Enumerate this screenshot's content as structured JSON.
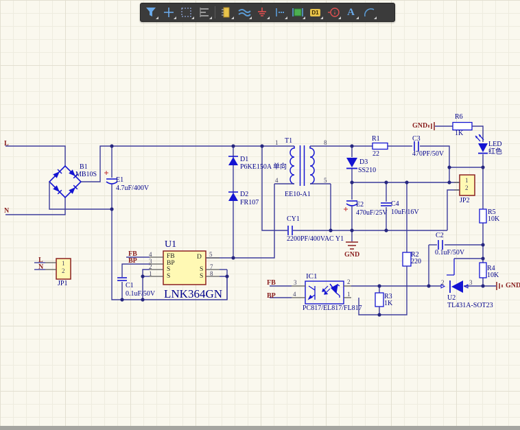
{
  "toolbar": {
    "icons": [
      "filter",
      "move",
      "select",
      "align",
      "part",
      "wire",
      "ground",
      "power-port",
      "ic",
      "designator",
      "info",
      "text",
      "arc"
    ],
    "d1_label": "D1",
    "text_label": "A"
  },
  "nets": {
    "l": "L",
    "n": "N",
    "fb": "FB",
    "bp": "BP",
    "gnd": "GND"
  },
  "c": {
    "b1": {
      "designator": "B1",
      "value": "MB10S"
    },
    "e1": {
      "designator": "E1",
      "value": "4.7uF/400V"
    },
    "d1": {
      "designator": "D1",
      "value": "P6KE150A 单向"
    },
    "d2": {
      "designator": "D2",
      "value": "FR107"
    },
    "t1": {
      "designator": "T1",
      "value": "EE10-A1",
      "pins": [
        "1",
        "8",
        "4",
        "5"
      ]
    },
    "cy1": {
      "designator": "CY1",
      "value": "2200PF/400VAC Y1"
    },
    "u1": {
      "designator": "U1",
      "value": "LNK364GN",
      "pn": [
        "4",
        "3",
        "2",
        "1",
        "5",
        "7",
        "8"
      ],
      "names": [
        "FB",
        "BP",
        "S",
        "S",
        "D",
        "S",
        "S"
      ]
    },
    "c1": {
      "designator": "C1",
      "value": "0.1uF/50V"
    },
    "jp1": {
      "designator": "JP1",
      "pins": [
        "1",
        "2"
      ]
    },
    "d3": {
      "designator": "D3",
      "value": "SS210"
    },
    "r1": {
      "designator": "R1",
      "value": "22"
    },
    "c3": {
      "designator": "C3",
      "value": "470PF/50V"
    },
    "r6": {
      "designator": "R6",
      "value": "1K"
    },
    "led": {
      "designator": "LED",
      "value": "红色"
    },
    "jp2": {
      "designator": "JP2",
      "pins": [
        "1",
        "2"
      ]
    },
    "r5": {
      "designator": "R5",
      "value": "10K"
    },
    "e2": {
      "designator": "E2",
      "value": "470uF/25V"
    },
    "c4": {
      "designator": "C4",
      "value": "10uF/16V"
    },
    "r2": {
      "designator": "R2",
      "value": "220"
    },
    "c2": {
      "designator": "C2",
      "value": "0.1uF/50V"
    },
    "ic1": {
      "designator": "IC1",
      "value": "PC817/EL817/FL817",
      "pn": [
        "3",
        "4",
        "2",
        "1"
      ]
    },
    "r3": {
      "designator": "R3",
      "value": "1K"
    },
    "r4": {
      "designator": "R4",
      "value": "10K"
    },
    "u2": {
      "designator": "U2",
      "value": "TL431A-SOT23",
      "pn": [
        "2",
        "3"
      ]
    }
  },
  "colors": {
    "wire": "#3c3c9c",
    "symbol": "#1414d2",
    "junction": "#26267f",
    "pin": "#5a5a5a",
    "net_label": "#8a1f1f",
    "designator": "#00008b",
    "part_fill": "#fff9b4",
    "part_border": "#8b2020",
    "background": "#faf8ee",
    "toolbar_bg": "#3b3b3b"
  }
}
